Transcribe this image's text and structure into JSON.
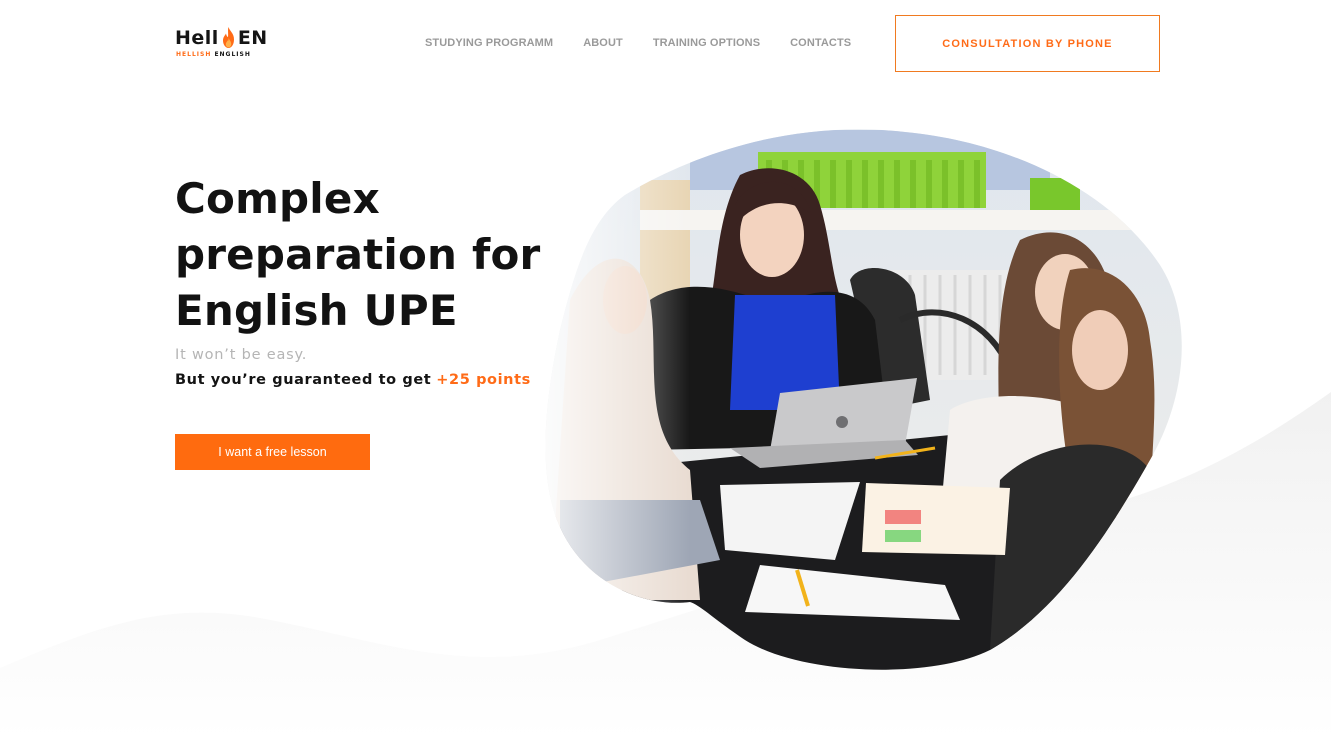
{
  "header": {
    "logo": {
      "word_left": "Hell",
      "word_right": "EN",
      "sub_left": "HELLISH",
      "sub_right": "ENGLISH",
      "icon": "flame-icon"
    },
    "nav": [
      {
        "label": "STUDYING PROGRAMM"
      },
      {
        "label": "ABOUT"
      },
      {
        "label": "TRAINING OPTIONS"
      },
      {
        "label": "CONTACTS"
      }
    ],
    "consult_label": "CONSULTATION BY PHONE"
  },
  "hero": {
    "title_lines": [
      "Complex",
      "preparation for",
      "English UPE"
    ],
    "subtitle": "It won’t be easy.",
    "guarantee_text": "But you’re guaranteed to get",
    "points": "+25 points",
    "cta_label": "I want a free lesson",
    "photo": "classroom-photo"
  },
  "colors": {
    "accent": "#ff6b0f",
    "text": "#141414",
    "muted": "#9a9a9a",
    "subtitle": "#b5b5b5"
  }
}
